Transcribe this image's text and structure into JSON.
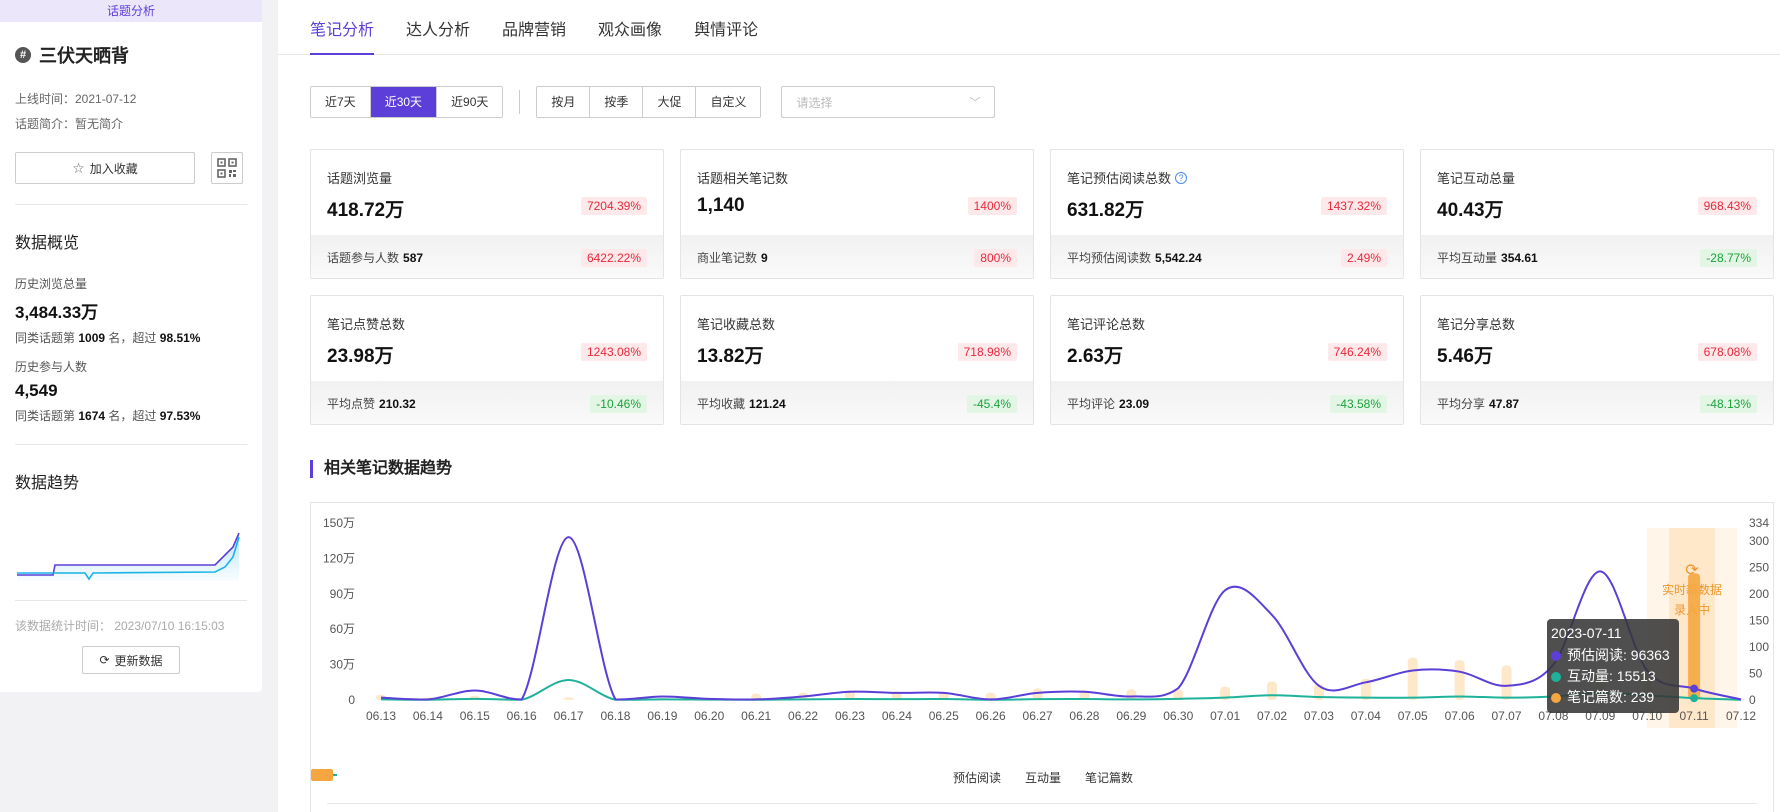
{
  "sidebar": {
    "tag": "话题分析",
    "topic_title": "三伏天晒背",
    "online_time": "上线时间：2021-07-12",
    "intro": "话题简介：暂无简介",
    "fav_label": "加入收藏",
    "overview_title": "数据概览",
    "history_views_label": "历史浏览总量",
    "history_views_value": "3,484.33万",
    "history_views_rank_prefix": "同类话题第",
    "history_views_rank": "1009",
    "history_views_rank_mid": "名，超过",
    "history_views_pct": "98.51%",
    "history_users_label": "历史参与人数",
    "history_users_value": "4,549",
    "history_users_rank_prefix": "同类话题第",
    "history_users_rank": "1674",
    "history_users_rank_mid": "名，超过",
    "history_users_pct": "97.53%",
    "trend_title": "数据趋势",
    "stat_time": "该数据统计时间： 2023/07/10 16:15:03",
    "refresh_label": "更新数据"
  },
  "tabs": [
    "笔记分析",
    "达人分析",
    "品牌营销",
    "观众画像",
    "舆情评论"
  ],
  "active_tab": 0,
  "filters": {
    "range": [
      "近7天",
      "近30天",
      "近90天"
    ],
    "range_active": 1,
    "period": [
      "按月",
      "按季",
      "大促",
      "自定义"
    ],
    "select_placeholder": "请选择"
  },
  "cards": [
    {
      "label": "话题浏览量",
      "value": "418.72万",
      "pct": "7204.39%",
      "dir": "up",
      "sub_label": "话题参与人数",
      "sub_value": "587",
      "sub_pct": "6422.22%",
      "sub_dir": "up",
      "help": false
    },
    {
      "label": "话题相关笔记数",
      "value": "1,140",
      "pct": "1400%",
      "dir": "up",
      "sub_label": "商业笔记数",
      "sub_value": "9",
      "sub_pct": "800%",
      "sub_dir": "up",
      "help": false
    },
    {
      "label": "笔记预估阅读总数",
      "value": "631.82万",
      "pct": "1437.32%",
      "dir": "up",
      "sub_label": "平均预估阅读数",
      "sub_value": "5,542.24",
      "sub_pct": "2.49%",
      "sub_dir": "up",
      "help": true
    },
    {
      "label": "笔记互动总量",
      "value": "40.43万",
      "pct": "968.43%",
      "dir": "up",
      "sub_label": "平均互动量",
      "sub_value": "354.61",
      "sub_pct": "-28.77%",
      "sub_dir": "down",
      "help": false
    },
    {
      "label": "笔记点赞总数",
      "value": "23.98万",
      "pct": "1243.08%",
      "dir": "up",
      "sub_label": "平均点赞",
      "sub_value": "210.32",
      "sub_pct": "-10.46%",
      "sub_dir": "down",
      "help": false
    },
    {
      "label": "笔记收藏总数",
      "value": "13.82万",
      "pct": "718.98%",
      "dir": "up",
      "sub_label": "平均收藏",
      "sub_value": "121.24",
      "sub_pct": "-45.4%",
      "sub_dir": "down",
      "help": false
    },
    {
      "label": "笔记评论总数",
      "value": "2.63万",
      "pct": "746.24%",
      "dir": "up",
      "sub_label": "平均评论",
      "sub_value": "23.09",
      "sub_pct": "-43.58%",
      "sub_dir": "down",
      "help": false
    },
    {
      "label": "笔记分享总数",
      "value": "5.46万",
      "pct": "678.08%",
      "dir": "up",
      "sub_label": "平均分享",
      "sub_value": "47.87",
      "sub_pct": "-48.13%",
      "sub_dir": "down",
      "help": false
    }
  ],
  "trend_section_title": "相关笔记数据趋势",
  "live_text_1": "实时新数据",
  "live_text_2": "录入中",
  "tooltip": {
    "date": "2023-07-11",
    "rows": [
      "预估阅读: 96363",
      "互动量: 15513",
      "笔记篇数: 239"
    ]
  },
  "colors": {
    "accent": "#5b3fd8",
    "read": "#5b3fd8",
    "interact": "#1fb29a",
    "notes": "#f5a640",
    "notes_light": "#fde2bc",
    "up": "#e8293c",
    "down": "#1aa33a"
  },
  "chart_data": {
    "type": "line",
    "categories": [
      "06.13",
      "06.14",
      "06.15",
      "06.16",
      "06.17",
      "06.18",
      "06.19",
      "06.20",
      "06.21",
      "06.22",
      "06.23",
      "06.24",
      "06.25",
      "06.26",
      "06.27",
      "06.28",
      "06.29",
      "06.30",
      "07.01",
      "07.02",
      "07.03",
      "07.04",
      "07.05",
      "07.06",
      "07.07",
      "07.08",
      "07.09",
      "07.10",
      "07.11",
      "07.12"
    ],
    "y_left_ticks": [
      "150万",
      "120万",
      "90万",
      "60万",
      "30万",
      "0"
    ],
    "y_left_max": 1500000,
    "y_right_ticks": [
      "334",
      "300",
      "250",
      "200",
      "150",
      "100",
      "50",
      "0"
    ],
    "y_right_max": 334,
    "series": [
      {
        "name": "预估阅读",
        "axis": "left",
        "values": [
          20000,
          5000,
          80000,
          5000,
          1380000,
          5000,
          30000,
          10000,
          5000,
          30000,
          70000,
          60000,
          60000,
          5000,
          60000,
          70000,
          30000,
          100000,
          930000,
          720000,
          120000,
          150000,
          250000,
          240000,
          120000,
          300000,
          1090000,
          250000,
          96363,
          5000
        ]
      },
      {
        "name": "互动量",
        "axis": "left",
        "values": [
          5000,
          2000,
          10000,
          2000,
          170000,
          2000,
          5000,
          3000,
          2000,
          5000,
          8000,
          7000,
          8000,
          2000,
          7000,
          8000,
          5000,
          10000,
          20000,
          40000,
          25000,
          20000,
          20000,
          30000,
          20000,
          30000,
          60000,
          40000,
          15513,
          2000
        ]
      },
      {
        "name": "笔记篇数",
        "axis": "right",
        "type": "bar",
        "values": [
          10,
          5,
          8,
          3,
          5,
          2,
          4,
          3,
          12,
          14,
          18,
          16,
          15,
          14,
          22,
          18,
          20,
          20,
          25,
          35,
          30,
          40,
          80,
          75,
          65,
          50,
          60,
          55,
          239,
          2
        ]
      }
    ],
    "highlight_index": 28
  }
}
